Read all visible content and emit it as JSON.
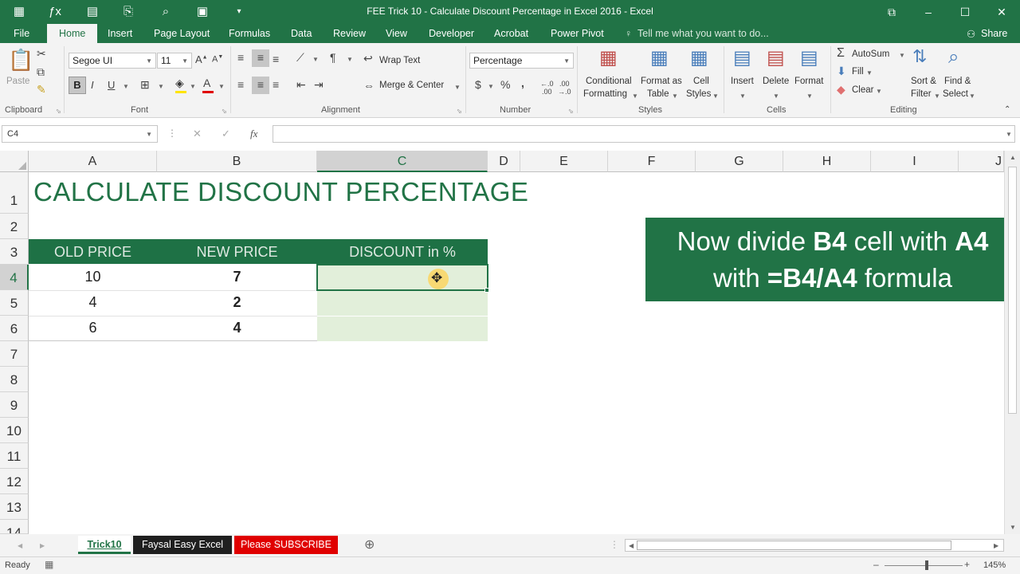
{
  "window": {
    "title": "FEE Trick 10 - Calculate Discount Percentage in Excel 2016 - Excel"
  },
  "tabs": [
    "File",
    "Home",
    "Insert",
    "Page Layout",
    "Formulas",
    "Data",
    "Review",
    "View",
    "Developer",
    "Acrobat",
    "Power Pivot"
  ],
  "tell_me": "Tell me what you want to do...",
  "share": "Share",
  "ribbon": {
    "clipboard": {
      "paste": "Paste",
      "group": "Clipboard"
    },
    "font": {
      "name": "Segoe UI",
      "size": "11",
      "bold": "B",
      "italic": "I",
      "underline": "U",
      "group": "Font"
    },
    "alignment": {
      "wrap": "Wrap Text",
      "merge": "Merge & Center",
      "group": "Alignment"
    },
    "number": {
      "format": "Percentage",
      "currency": "$",
      "percent": "%",
      "comma": ",",
      "group": "Number"
    },
    "styles": {
      "cond1": "Conditional",
      "cond2": "Formatting",
      "fmt1": "Format as",
      "fmt2": "Table",
      "cell1": "Cell",
      "cell2": "Styles",
      "group": "Styles"
    },
    "cells": {
      "insert": "Insert",
      "delete": "Delete",
      "format": "Format",
      "group": "Cells"
    },
    "editing": {
      "autosum": "AutoSum",
      "fill": "Fill",
      "clear": "Clear",
      "sort1": "Sort &",
      "sort2": "Filter",
      "find1": "Find &",
      "find2": "Select",
      "group": "Editing"
    }
  },
  "namebox": "C4",
  "fx": "fx",
  "columns": [
    "A",
    "B",
    "C",
    "D",
    "E",
    "F",
    "G",
    "H",
    "I",
    "J"
  ],
  "rows": [
    "1",
    "2",
    "3",
    "4",
    "5",
    "6",
    "7",
    "8",
    "9",
    "10",
    "11",
    "12",
    "13",
    "14"
  ],
  "sheet": {
    "title": "CALCULATE DISCOUNT PERCENTAGE",
    "headers": [
      "OLD PRICE",
      "NEW PRICE",
      "DISCOUNT in %"
    ],
    "data": [
      [
        "10",
        "7",
        ""
      ],
      [
        "4",
        "2",
        ""
      ],
      [
        "6",
        "4",
        ""
      ]
    ]
  },
  "callout": {
    "l1a": "Now divide ",
    "l1b": "B4",
    "l1c": " cell with ",
    "l1d": "A4",
    "l2a": "with ",
    "l2b": "=B4/A4",
    "l2c": " formula"
  },
  "sheets": [
    "Trick10",
    "Faysal Easy Excel",
    "Please SUBSCRIBE"
  ],
  "status": {
    "ready": "Ready",
    "zoom": "145%"
  },
  "colors": {
    "excel_green": "#217346",
    "header_green": "#1e7145",
    "light_green": "#e2efda",
    "callout": "#217346",
    "sheet_black": "#1f1f1f",
    "sheet_red": "#e00000"
  }
}
